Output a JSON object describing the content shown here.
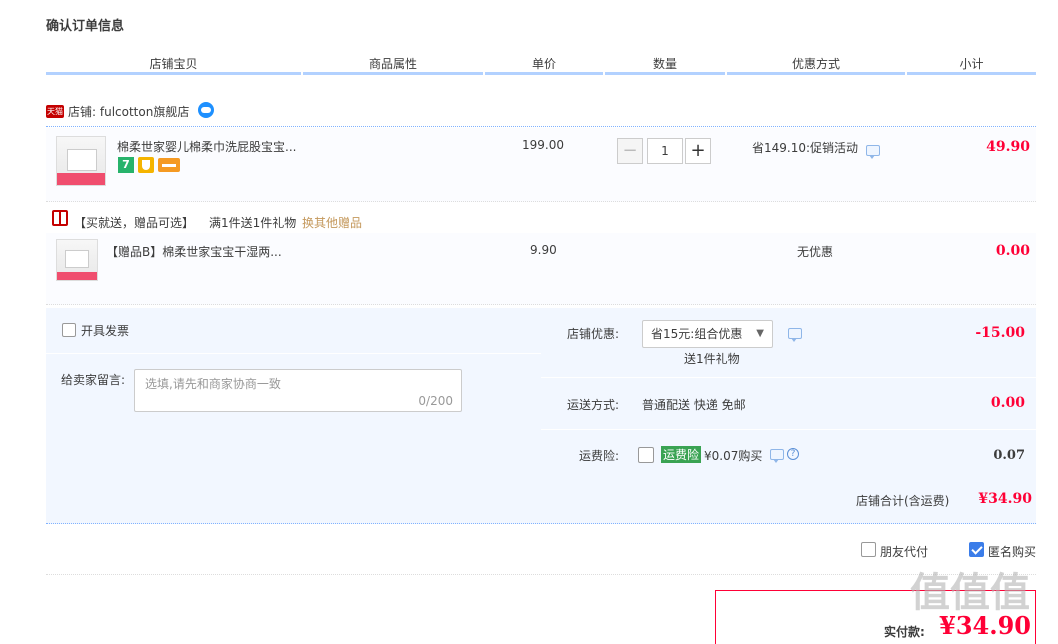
{
  "page": {
    "title": "确认订单信息"
  },
  "columns": [
    "店铺宝贝",
    "商品属性",
    "单价",
    "数量",
    "优惠方式",
    "小计"
  ],
  "shop": {
    "badge": "天猫",
    "label": "店铺: fulcotton旗舰店"
  },
  "item": {
    "name": "棉柔世家婴儿棉柔巾洗屁股宝宝...",
    "tag_number": "7",
    "price": "199.00",
    "quantity": "1",
    "minus": "−",
    "plus": "+",
    "discount": "省149.10:促销活动",
    "subtotal": "49.90"
  },
  "gift": {
    "promo_label": "【买就送，赠品可选】",
    "promo_rule": "满1件送1件礼物",
    "change_link": "换其他赠品",
    "name": "【赠品B】棉柔世家宝宝干湿两...",
    "price": "9.90",
    "discount": "无优惠",
    "subtotal": "0.00"
  },
  "invoice": {
    "label": "开具发票",
    "checked": false
  },
  "message": {
    "label": "给卖家留言:",
    "placeholder": "选填,请先和商家协商一致",
    "counter": "0/200"
  },
  "shop_discount": {
    "label": "店铺优惠:",
    "selected": "省15元:组合优惠",
    "note": "送1件礼物",
    "amount": "-15.00"
  },
  "shipping": {
    "label": "运送方式:",
    "method": "普通配送 快递 免邮",
    "amount": "0.00"
  },
  "insurance": {
    "label": "运费险:",
    "badge": "运费险",
    "price_text": "¥0.07购买",
    "amount": "0.07",
    "help": "?"
  },
  "shop_total": {
    "label": "店铺合计(含运费)",
    "amount": "¥34.90"
  },
  "options": {
    "friend_pay": {
      "label": "朋友代付",
      "checked": false
    },
    "anonymous": {
      "label": "匿名购买",
      "checked": true
    }
  },
  "pay": {
    "label": "实付款:",
    "amount": "¥34.90"
  },
  "watermark": "值值值",
  "colors": {
    "accent_red": "#ff0036",
    "header_line": "#b2d1ff",
    "panel_bg": "#f2f7ff",
    "checkbox_blue": "#3b7de9"
  }
}
